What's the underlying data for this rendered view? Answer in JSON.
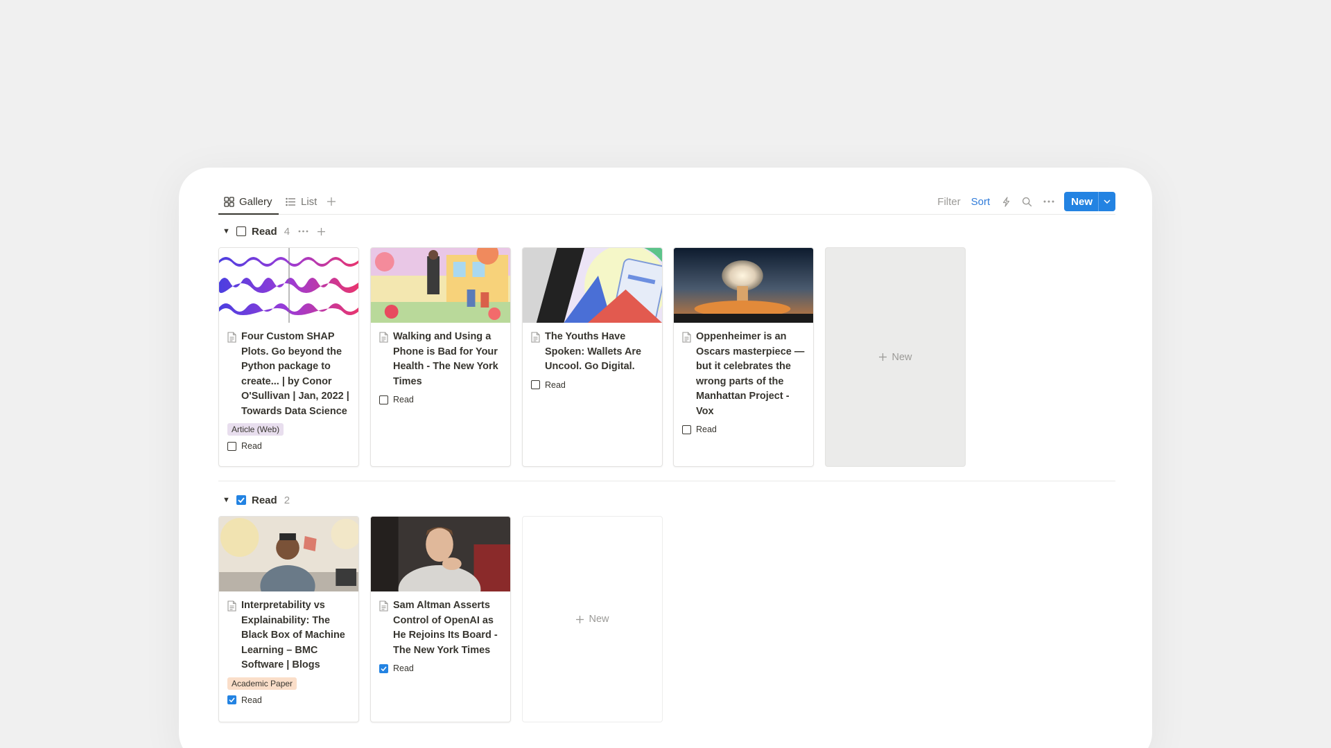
{
  "tabs": [
    {
      "label": "Gallery",
      "active": true
    },
    {
      "label": "List",
      "active": false
    }
  ],
  "toolbar": {
    "filter_label": "Filter",
    "sort_label": "Sort",
    "new_label": "New",
    "accent_color": "#2f7bd9",
    "button_color": "#2383e2"
  },
  "groups": [
    {
      "label": "Read",
      "checked": false,
      "count": "4",
      "cards": [
        {
          "title": "Four Custom SHAP Plots. Go beyond the Python package to create... | by Conor O'Sullivan | Jan, 2022 | Towards Data Science",
          "tag": "Article (Web)",
          "read_label": "Read",
          "read": false,
          "thumbnail": "audio-waveform-image"
        },
        {
          "title": "Walking and Using a Phone is Bad for Your Health - The New York Times",
          "read_label": "Read",
          "read": false,
          "thumbnail": "illustrated-street-scene-image"
        },
        {
          "title": "The Youths Have Spoken: Wallets Are Uncool. Go Digital.",
          "read_label": "Read",
          "read": false,
          "thumbnail": "phone-wallet-illustration-image"
        },
        {
          "title": "Oppenheimer is an Oscars masterpiece — but it celebrates the wrong parts of the Manhattan Project - Vox",
          "read_label": "Read",
          "read": false,
          "thumbnail": "mushroom-cloud-image"
        }
      ],
      "new_card_label": "New"
    },
    {
      "label": "Read",
      "checked": true,
      "count": "2",
      "cards": [
        {
          "title": "Interpretability vs Explainability: The Black Box of Machine Learning – BMC Software | Blogs",
          "tag": "Academic Paper",
          "read_label": "Read",
          "read": true,
          "thumbnail": "person-holding-cube-image"
        },
        {
          "title": "Sam Altman Asserts Control of OpenAI as He Rejoins Its Board - The New York Times",
          "read_label": "Read",
          "read": true,
          "thumbnail": "portrait-photo-image"
        }
      ],
      "new_card_label": "New"
    }
  ]
}
